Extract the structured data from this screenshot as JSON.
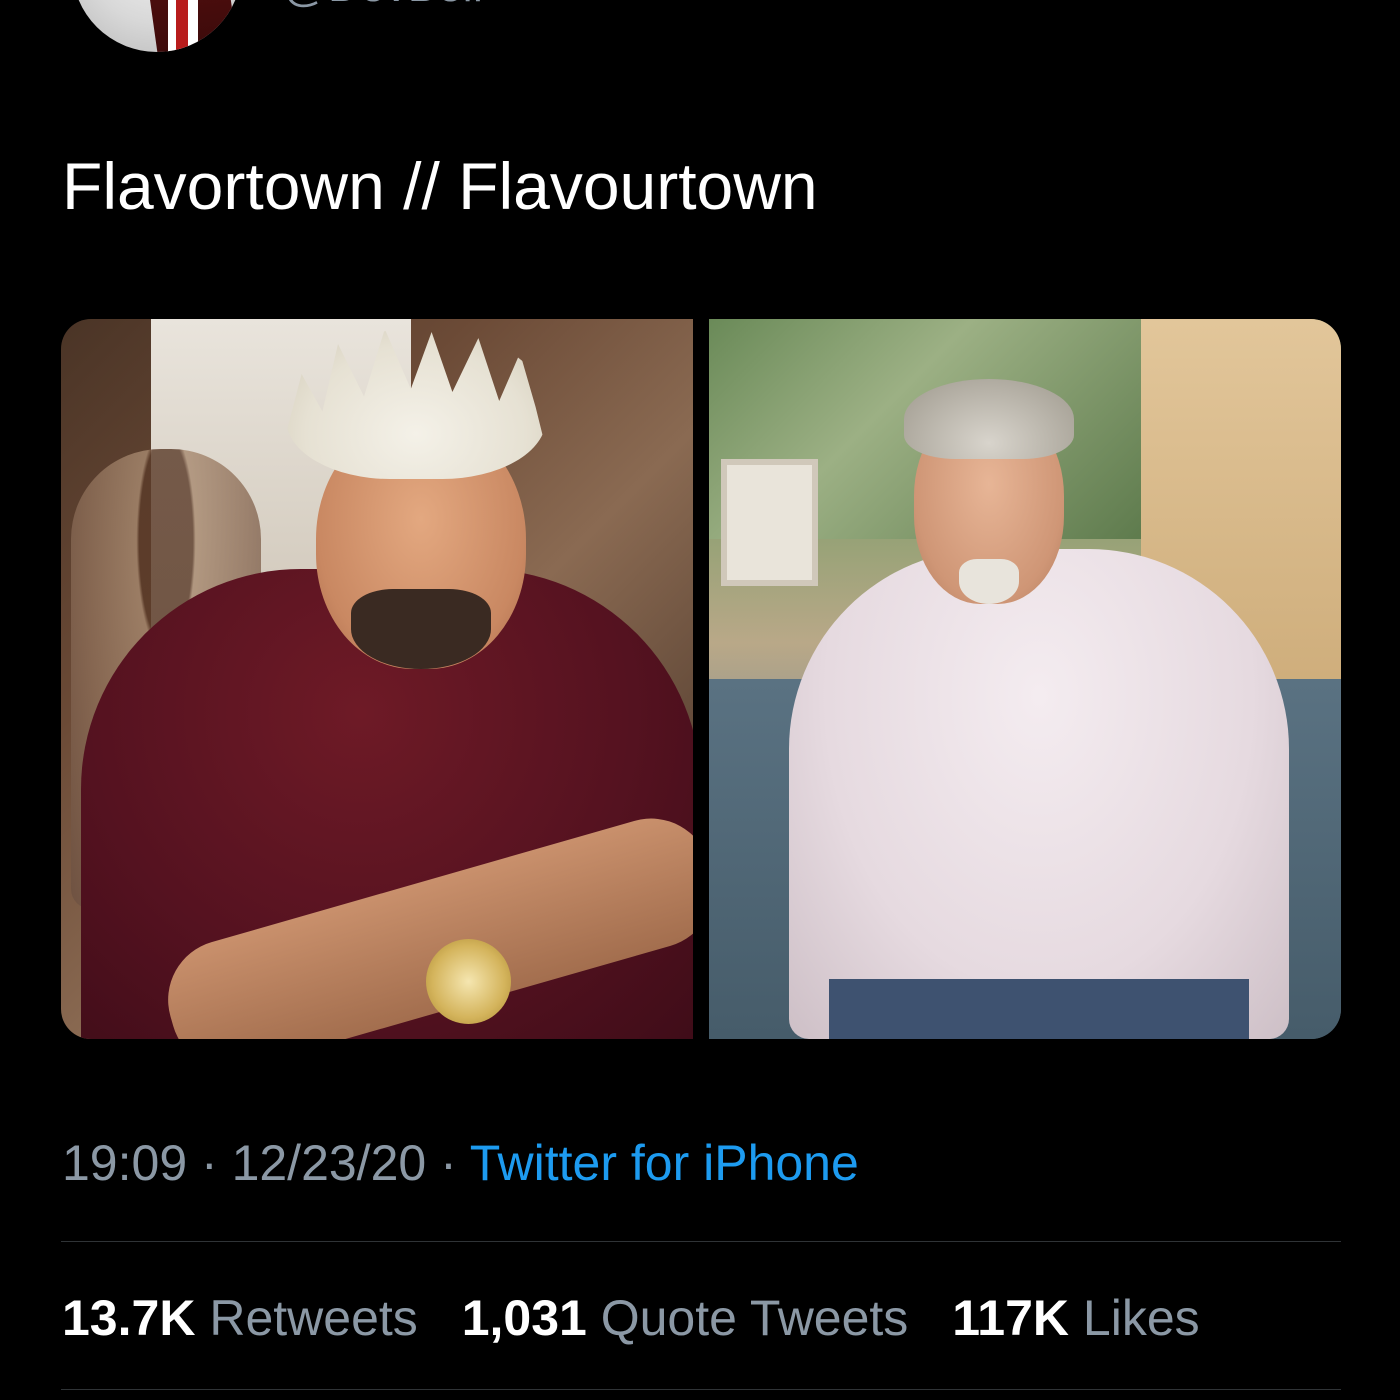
{
  "author": {
    "handle": "@DevBell"
  },
  "tweet": {
    "text": "Flavortown // Flavourtown",
    "time": "19:09",
    "date": "12/23/20",
    "separator": " · ",
    "source": "Twitter for iPhone"
  },
  "media": [
    {
      "name": "photo-left"
    },
    {
      "name": "photo-right"
    }
  ],
  "stats": {
    "retweets_count": "13.7K",
    "retweets_label": "Retweets",
    "quotes_count": "1,031",
    "quotes_label": "Quote Tweets",
    "likes_count": "117K",
    "likes_label": "Likes"
  },
  "colors": {
    "background": "#000000",
    "text": "#ffffff",
    "secondary": "#8b98a5",
    "link": "#1d9bf0",
    "divider": "#2f3336"
  }
}
